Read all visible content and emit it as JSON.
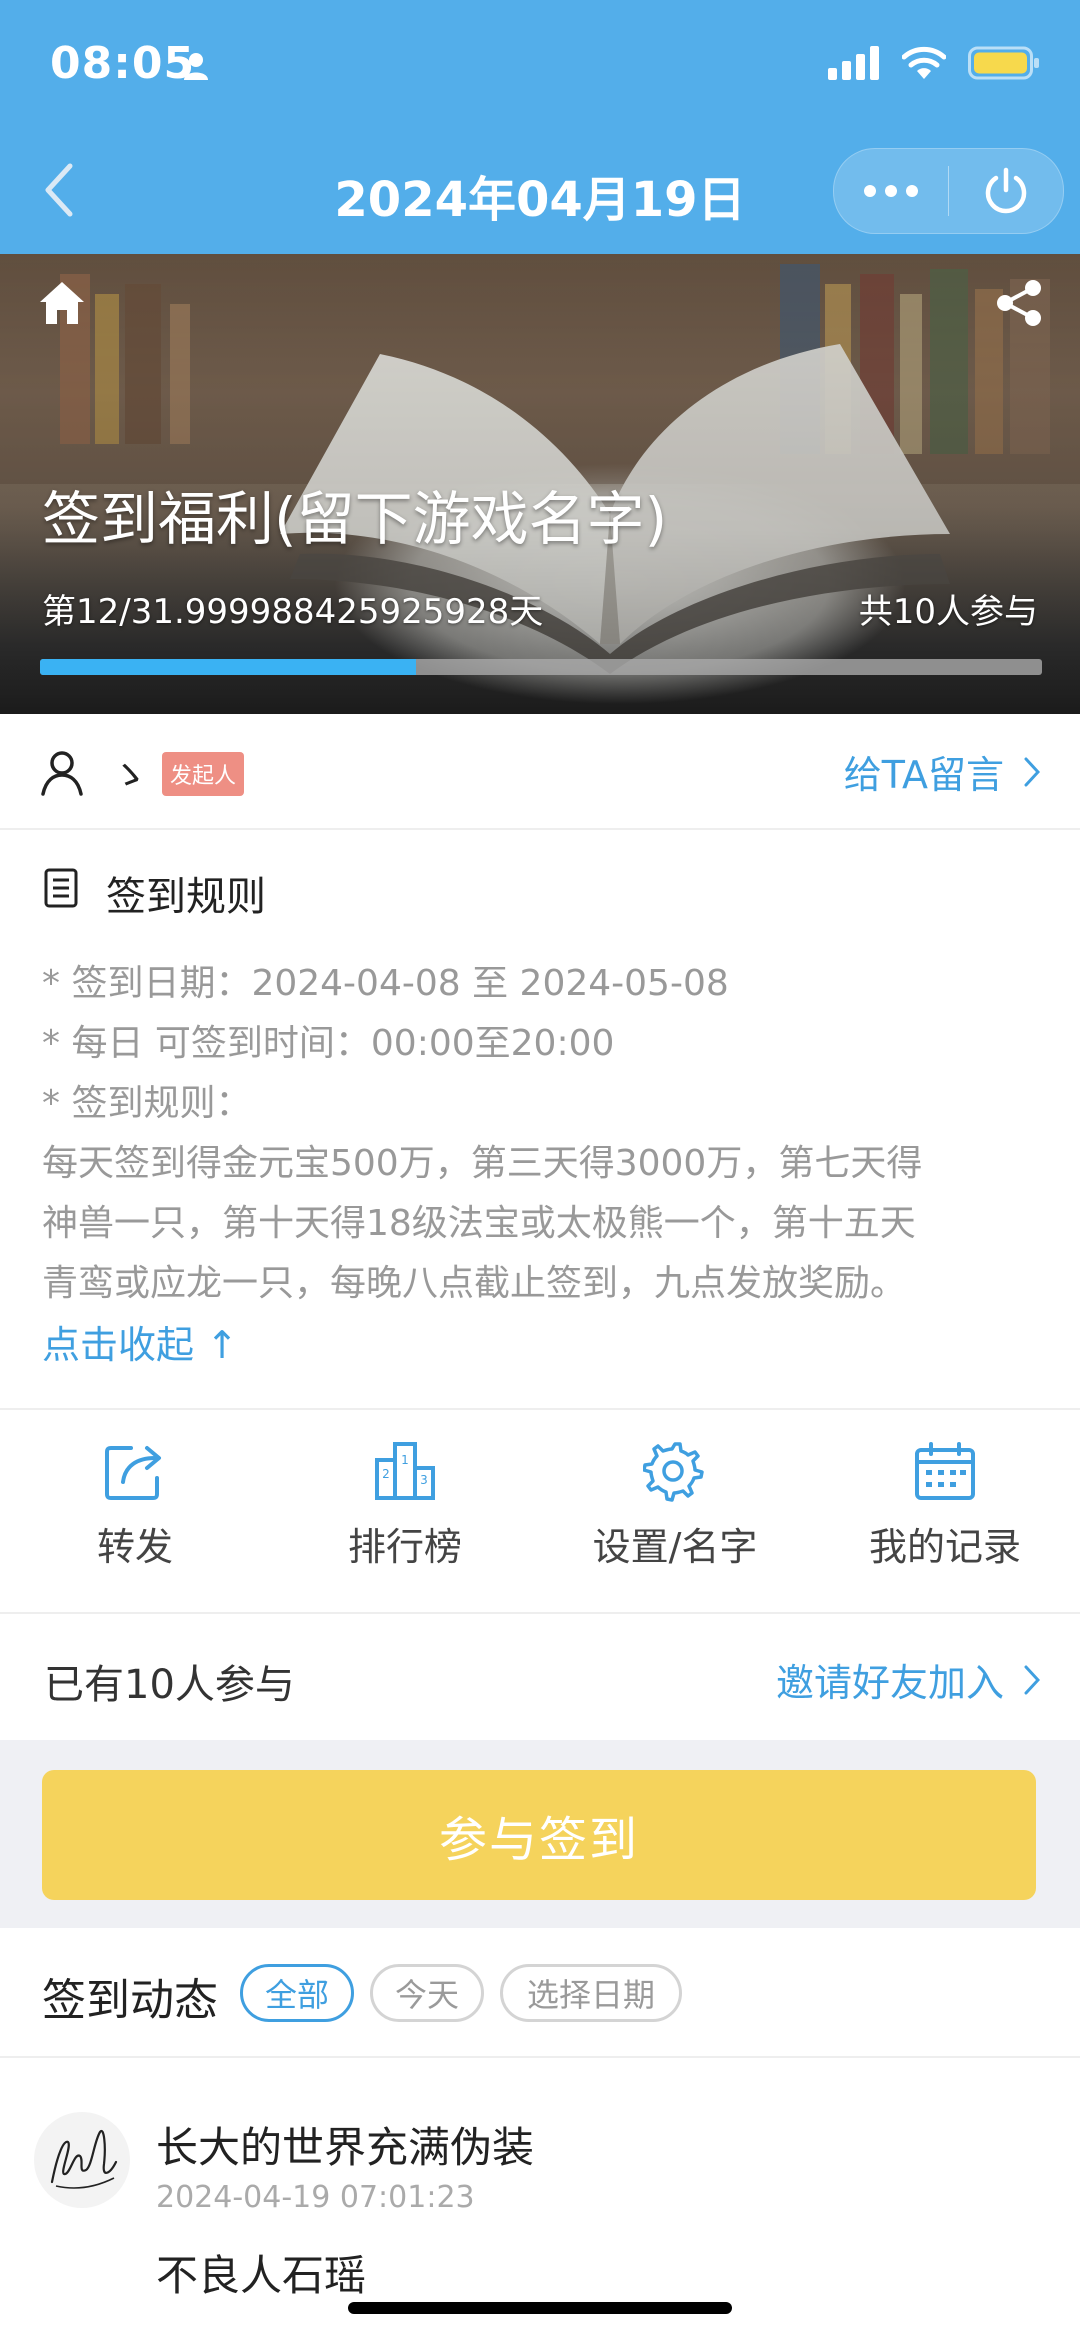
{
  "status_bar": {
    "time": "08:05"
  },
  "nav": {
    "title": "2024年04月19日"
  },
  "banner": {
    "title": "签到福利(留下游戏名字)",
    "day_progress": "第12/31.999988425925928天",
    "participant_count": "共10人参与",
    "progress_fraction": 0.375
  },
  "initiator": {
    "name": "ゝ",
    "badge": "发起人",
    "leave_message_label": "给TA留言"
  },
  "rules": {
    "heading": "签到规则",
    "lines": [
      "* 签到日期：2024-04-08 至 2024-05-08",
      "* 每日 可签到时间：00:00至20:00",
      "* 签到规则：",
      "每天签到得金元宝500万，第三天得3000万，第七天得",
      "神兽一只，第十天得18级法宝或太极熊一个，第十五天",
      "青鸾或应龙一只，每晚八点截止签到，九点发放奖励。"
    ],
    "collapse_label": "点击收起 ↑"
  },
  "actions": [
    {
      "label": "转发",
      "icon": "forward-icon"
    },
    {
      "label": "排行榜",
      "icon": "ranking-icon"
    },
    {
      "label": "设置/名字",
      "icon": "gear-icon"
    },
    {
      "label": "我的记录",
      "icon": "calendar-icon"
    }
  ],
  "participants": {
    "text": "已有10人参与",
    "invite_label": "邀请好友加入"
  },
  "signin_button": {
    "label": "参与签到"
  },
  "feed": {
    "title": "签到动态",
    "filters": [
      "全部",
      "今天",
      "选择日期"
    ],
    "active_filter": "全部",
    "entries": [
      {
        "name": "长大的世界充满伪装",
        "time": "2024-04-19 07:01:23",
        "content": "不良人石瑶"
      }
    ]
  },
  "colors": {
    "header": "#53aeea",
    "accent_blue": "#3f9fe0",
    "progress": "#3ab2f3",
    "signin_button": "#f5d35c",
    "badge": "#ee8f84"
  }
}
